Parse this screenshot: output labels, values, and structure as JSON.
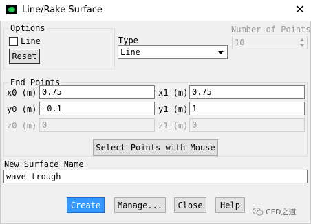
{
  "window": {
    "title": "Line/Rake Surface"
  },
  "options": {
    "group_label": "Options",
    "line_label": "Line",
    "line_checked": false,
    "reset_label": "Reset"
  },
  "type": {
    "label": "Type",
    "selected": "Line"
  },
  "num_points": {
    "label": "Number of Points",
    "value": "10"
  },
  "end_points": {
    "group_label": "End Points",
    "x0": {
      "label": "x0 (m)",
      "value": "0.75"
    },
    "x1": {
      "label": "x1 (m)",
      "value": "0.75"
    },
    "y0": {
      "label": "y0 (m)",
      "value": "-0.1"
    },
    "y1": {
      "label": "y1 (m)",
      "value": "1"
    },
    "z0": {
      "label": "z0 (m)",
      "value": "0"
    },
    "z1": {
      "label": "z1 (m)",
      "value": "0"
    }
  },
  "select_points_label": "Select Points with Mouse",
  "surface_name": {
    "label": "New Surface Name",
    "value": "wave_trough"
  },
  "footer": {
    "create": "Create",
    "manage": "Manage...",
    "close": "Close",
    "help": "Help"
  },
  "watermark": "CFD之道",
  "icons": [
    "app-icon",
    "close-icon",
    "chevron-down-icon",
    "spin-arrows-icon",
    "wechat-icon"
  ]
}
